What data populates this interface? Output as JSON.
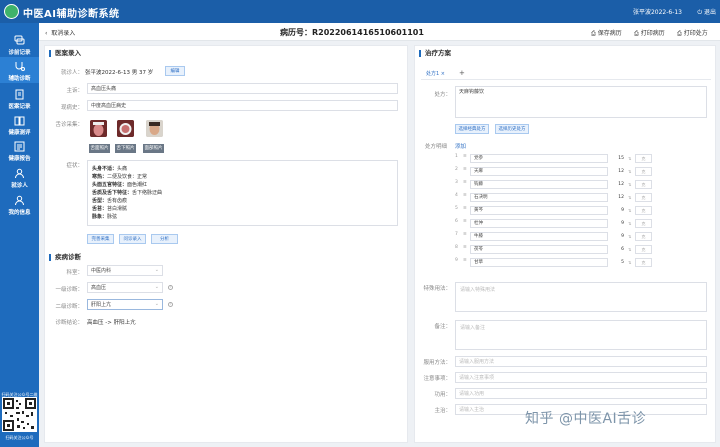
{
  "app": {
    "title": "中医AI辅助诊断系统",
    "user": "张平波2022-6-13",
    "logout": "退出"
  },
  "sidebar": {
    "items": [
      {
        "label": "诊前记录",
        "icon": "chat-icon"
      },
      {
        "label": "辅助诊断",
        "icon": "stethoscope-icon"
      },
      {
        "label": "医案记录",
        "icon": "record-icon"
      },
      {
        "label": "健康测评",
        "icon": "book-icon"
      },
      {
        "label": "健康报告",
        "icon": "report-icon"
      },
      {
        "label": "就诊人",
        "icon": "user-icon"
      },
      {
        "label": "我的信息",
        "icon": "user-circle-icon"
      }
    ],
    "qr_label": "扫码关注公众号二维码",
    "qr_caption": "扫码关注公众号"
  },
  "header": {
    "back": "取消录入",
    "record_no": "病历号：R2022061416510601101",
    "save": "保存病历",
    "print": "打印病历",
    "print_rx": "打印处方"
  },
  "left": {
    "section_title": "医案录入",
    "patient_label": "就诊人：",
    "patient_value": "张平波2022-6-13  男  37 岁",
    "edit_btn": "编辑",
    "complaint_label": "主诉：",
    "complaint_value": "高血压头痛",
    "present_label": "现病史：",
    "present_value": "中度高血压病史",
    "photos_label": "舌诊采集：",
    "photos": [
      "舌面照片",
      "舌下照片",
      "面部照片"
    ],
    "symptom_label": "症状：",
    "symptoms": [
      {
        "k": "头身不适：",
        "v": "头痛"
      },
      {
        "k": "寒热：",
        "v": "二便及饮食：正常"
      },
      {
        "k": "头面五官特征：",
        "v": "面色潮红"
      },
      {
        "k": "舌质及舌下特征：",
        "v": "舌下络脉迂曲"
      },
      {
        "k": "舌型：",
        "v": "舌有齿痕"
      },
      {
        "k": "舌苔：",
        "v": "苔白滑腻"
      },
      {
        "k": "脉象：",
        "v": "脉弦"
      }
    ],
    "symptom_buttons": [
      "完善采集",
      "问诊录入",
      "分析"
    ],
    "diag_title": "疾病诊断",
    "dept_label": "科室：",
    "dept_value": "中医内科",
    "disease1_label": "一级诊断：",
    "disease1_value": "高血压",
    "disease2_label": "二级诊断：",
    "disease2_value": "肝阳上亢",
    "conclusion_label": "诊断结论：",
    "conclusion_value": "高血压 -> 肝阳上亢"
  },
  "right": {
    "section_title": "治疗方案",
    "tab": "处方1",
    "tab_add": "+",
    "rx_label": "处方：",
    "rx_value": "天麻钩藤饮",
    "rx_btn1": "选择经典处方",
    "rx_btn2": "选择历史处方",
    "detail_label": "处方明细",
    "detail_add": "添加",
    "herbs": [
      {
        "name": "党参",
        "dose": "15"
      },
      {
        "name": "天麻",
        "dose": "12"
      },
      {
        "name": "钩藤",
        "dose": "12"
      },
      {
        "name": "石决明",
        "dose": "12"
      },
      {
        "name": "黄芩",
        "dose": "9"
      },
      {
        "name": "杜仲",
        "dose": "9"
      },
      {
        "name": "牛膝",
        "dose": "9"
      },
      {
        "name": "茯苓",
        "dose": "6"
      },
      {
        "name": "甘草",
        "dose": "5"
      }
    ],
    "unit": "克",
    "special_label": "特殊用法：",
    "special_ph": "请输入特殊用法",
    "remark_label": "备注：",
    "remark_ph": "请输入备注",
    "usage_label": "服用方法：",
    "usage_ph": "请输入服用方法",
    "notice_label": "注意事项：",
    "notice_ph": "请输入注意事项",
    "efficacy_label": "功用：",
    "efficacy_ph": "请输入功用",
    "main_label": "主治：",
    "main_ph": "请输入主治"
  },
  "watermark": "知乎 @中医AI舌诊"
}
